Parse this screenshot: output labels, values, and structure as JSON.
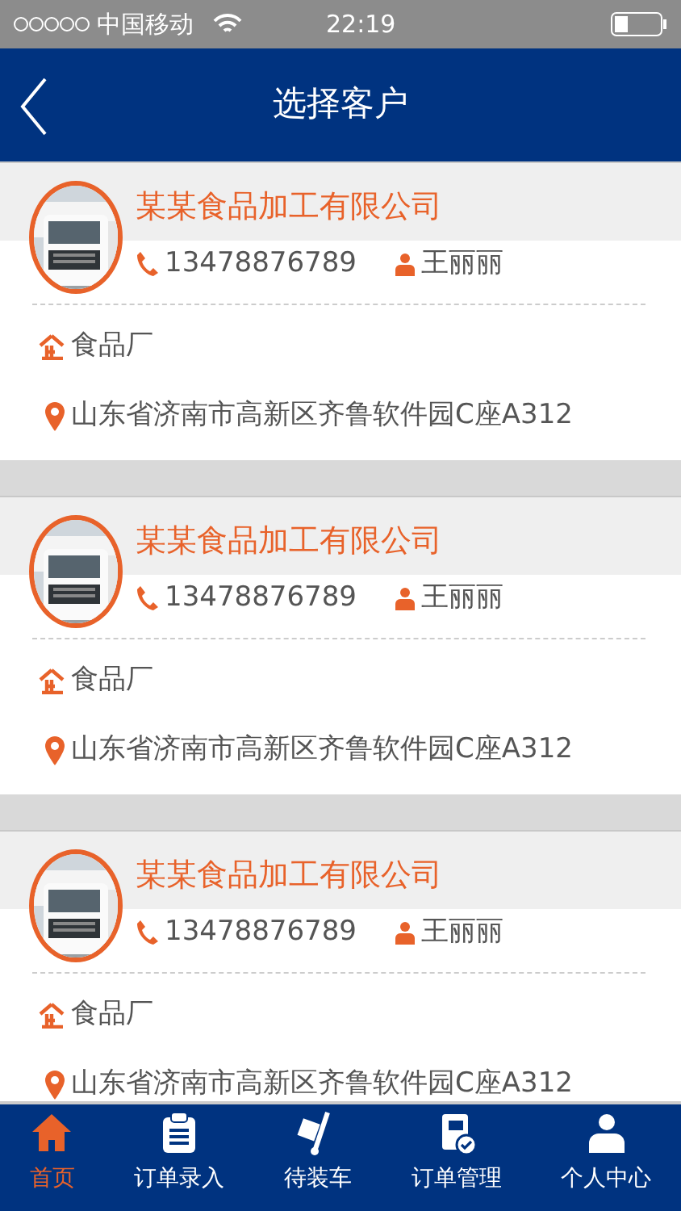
{
  "status_bar": {
    "carrier": "中国移动",
    "time": "22:19"
  },
  "header": {
    "title": "选择客户"
  },
  "customers": [
    {
      "name": "某某食品加工有限公司",
      "phone": "13478876789",
      "contact": "王丽丽",
      "company_type": "食品厂",
      "address": "山东省济南市高新区齐鲁软件园C座A312"
    },
    {
      "name": "某某食品加工有限公司",
      "phone": "13478876789",
      "contact": "王丽丽",
      "company_type": "食品厂",
      "address": "山东省济南市高新区齐鲁软件园C座A312"
    },
    {
      "name": "某某食品加工有限公司",
      "phone": "13478876789",
      "contact": "王丽丽",
      "company_type": "食品厂",
      "address": "山东省济南市高新区齐鲁软件园C座A312"
    }
  ],
  "tab_bar": [
    {
      "kind": "home",
      "label": "首页",
      "selected": true
    },
    {
      "kind": "clipboard",
      "label": "订单录入",
      "selected": false
    },
    {
      "kind": "trolley",
      "label": "待装车",
      "selected": false
    },
    {
      "kind": "notebook",
      "label": "订单管理",
      "selected": false
    },
    {
      "kind": "person",
      "label": "个人中心",
      "selected": false
    }
  ]
}
